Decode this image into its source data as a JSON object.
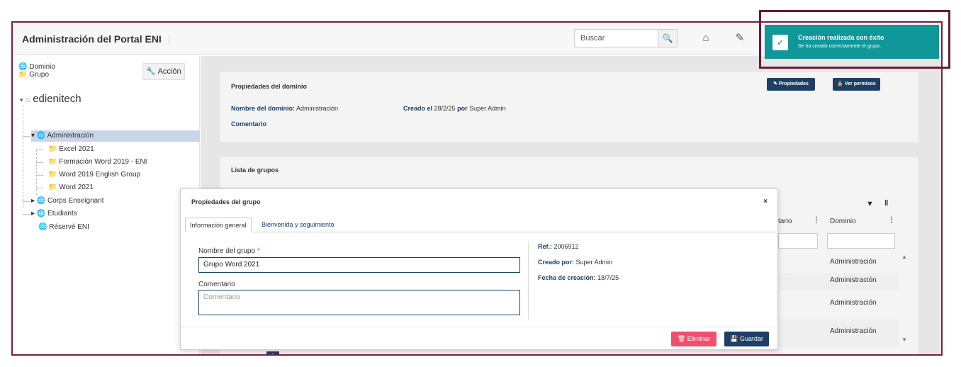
{
  "header": {
    "app_title": "Administración del Portal ENI",
    "search_placeholder": "Buscar",
    "icons": [
      "search-icon",
      "home-icon",
      "edit-icon"
    ]
  },
  "sidebar": {
    "top_links": [
      "Dominio",
      "Grupo"
    ],
    "action_label": "Acción",
    "root": "edienitech",
    "items": [
      {
        "label": "Administración",
        "level": 1,
        "selected": true
      },
      {
        "label": "Excel 2021",
        "level": 2
      },
      {
        "label": "Formación Word 2019 - ENI",
        "level": 2
      },
      {
        "label": "Word 2019 English Group",
        "level": 2
      },
      {
        "label": "Word 2021",
        "level": 2
      },
      {
        "label": "Corps Enseignant",
        "level": 1
      },
      {
        "label": "Etudiants",
        "level": 1
      },
      {
        "label": "Réservé ENI",
        "level": 1
      }
    ]
  },
  "domain_panel": {
    "title": "Propiedades del dominio",
    "btn_properties": "Propiedades",
    "btn_permissions": "Ver permisos",
    "name_label": "Nombre del dominio:",
    "name_value": "Administración",
    "created_label": "Creado el",
    "created_date": "28/2/25",
    "created_by_label": "por",
    "created_by": "Super Admin",
    "comment_label": "Comentario"
  },
  "groups_panel": {
    "title": "Lista de grupos",
    "col_partial": "tario",
    "col_domain": "Dominio",
    "rows": [
      "Administración",
      "Administración",
      "Administración",
      "Administración"
    ],
    "page_number": "1"
  },
  "modal": {
    "title": "Propiedades del grupo",
    "close": "×",
    "tabs": [
      "Información general",
      "Bienvenida y seguimiento"
    ],
    "name_label": "Nombre del grupo",
    "name_required": "*",
    "name_value": "Grupo Word 2021",
    "comment_label": "Comentario",
    "comment_placeholder": "Comentario",
    "ref_label": "Ref.:",
    "ref_value": "2006912",
    "created_by_label": "Creado por:",
    "created_by_value": "Super Admin",
    "created_date_label": "Fecha de creación:",
    "created_date_value": "18/7/25",
    "delete_label": "Eliminar",
    "save_label": "Guardar"
  },
  "toast": {
    "title": "Creación realizada con éxito",
    "message": "Se ha creado correctamente el grupo.",
    "color": "#10979a"
  }
}
